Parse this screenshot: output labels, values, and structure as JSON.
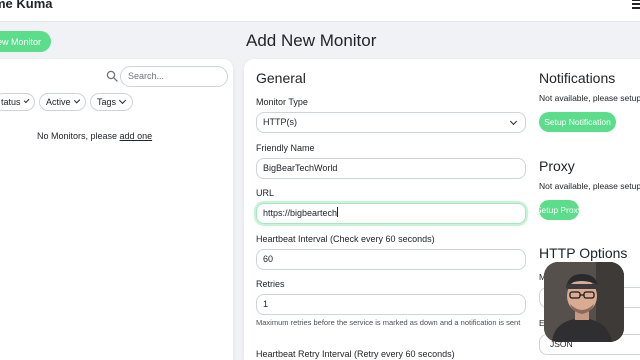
{
  "app": {
    "title": "me Kuma"
  },
  "sidebar": {
    "add_button": "ew Monitor",
    "search_placeholder": "Search...",
    "filters": [
      "tatus",
      "Active",
      "Tags"
    ],
    "empty_text": "No Monitors, please ",
    "empty_link": "add one"
  },
  "page": {
    "title": "Add New Monitor"
  },
  "general": {
    "heading": "General",
    "monitor_type_label": "Monitor Type",
    "monitor_type_value": "HTTP(s)",
    "friendly_name_label": "Friendly Name",
    "friendly_name_value": "BigBearTechWorld",
    "url_label": "URL",
    "url_value": "https://bigbeartech",
    "heartbeat_label": "Heartbeat Interval (Check every 60 seconds)",
    "heartbeat_value": "60",
    "retries_label": "Retries",
    "retries_value": "1",
    "retries_hint": "Maximum retries before the service is marked as down and a notification is sent",
    "retry_interval_label": "Heartbeat Retry Interval (Retry every 60 seconds)"
  },
  "notifications": {
    "heading": "Notifications",
    "note": "Not available, please setup",
    "button": "Setup Notification"
  },
  "proxy": {
    "heading": "Proxy",
    "note": "Not available, please setup",
    "button": "Setup Proxy"
  },
  "http_options": {
    "heading": "HTTP Options",
    "method_label": "M",
    "body_label": "E",
    "body_encoding_value": "JSON"
  },
  "colors": {
    "accent": "#5cdd8b",
    "background": "#f0f2f5"
  }
}
